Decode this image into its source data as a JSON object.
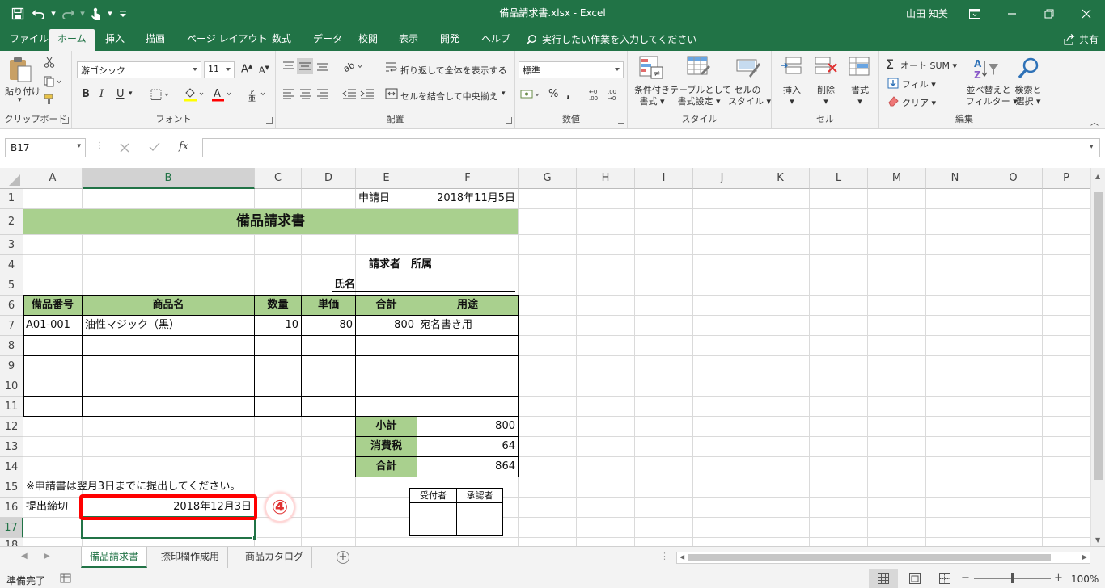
{
  "window": {
    "title": "備品請求書.xlsx  -  Excel",
    "user": "山田 知美"
  },
  "ribbon_tabs": [
    "ファイル",
    "ホーム",
    "挿入",
    "描画",
    "ページ レイアウト",
    "数式",
    "データ",
    "校閲",
    "表示",
    "開発",
    "ヘルプ"
  ],
  "active_tab": "ホーム",
  "search_placeholder": "実行したい作業を入力してください",
  "share_label": "共有",
  "ribbon": {
    "clipboard": {
      "label": "クリップボード",
      "paste": "貼り付け"
    },
    "font": {
      "label": "フォント",
      "name": "游ゴシック",
      "size": "11",
      "bold": "B",
      "italic": "I",
      "underline": "U"
    },
    "alignment": {
      "label": "配置",
      "wrap": "折り返して全体を表示する",
      "merge": "セルを結合して中央揃え"
    },
    "number": {
      "label": "数値",
      "format": "標準",
      "percent": "%"
    },
    "styles": {
      "label": "スタイル",
      "conditional": [
        "条件付き",
        "書式"
      ],
      "table": [
        "テーブルとして",
        "書式設定"
      ],
      "cell": [
        "セルの",
        "スタイル"
      ]
    },
    "cells": {
      "label": "セル",
      "insert": "挿入",
      "delete": "削除",
      "format": "書式"
    },
    "editing": {
      "label": "編集",
      "autosum": "オート SUM",
      "fill": "フィル",
      "clear": "クリア",
      "sort": [
        "並べ替えと",
        "フィルター"
      ],
      "find": [
        "検索と",
        "選択"
      ]
    }
  },
  "name_box": "B17",
  "columns": [
    "A",
    "B",
    "C",
    "D",
    "E",
    "F",
    "G",
    "H",
    "I",
    "J",
    "K",
    "L",
    "M",
    "N",
    "O",
    "P"
  ],
  "selected_column": "B",
  "rows": [
    "1",
    "2",
    "3",
    "4",
    "5",
    "6",
    "7",
    "8",
    "9",
    "10",
    "11",
    "12",
    "13",
    "14",
    "15",
    "16",
    "17",
    "18"
  ],
  "selected_row": "17",
  "sheet": {
    "request_date_label": "申請日",
    "request_date": "2018年11月5日",
    "title": "備品請求書",
    "requester_dept": "請求者　所属",
    "requester_name": "氏名",
    "headers": [
      "備品番号",
      "商品名",
      "数量",
      "単価",
      "合計",
      "用途"
    ],
    "items": [
      [
        "A01-001",
        "油性マジック（黒）",
        "10",
        "80",
        "800",
        "宛名書き用"
      ]
    ],
    "subtotal_label": "小計",
    "subtotal": "800",
    "tax_label": "消費税",
    "tax": "64",
    "total_label": "合計",
    "total": "864",
    "note": "※申請書は翌月3日までに提出してください。",
    "deadline_label": "提出締切",
    "deadline": "2018年12月3日",
    "stamp_headers": [
      "受付者",
      "承認者"
    ]
  },
  "callout": "④",
  "sheet_tabs": [
    "備品請求書",
    "捺印欄作成用",
    "商品カタログ"
  ],
  "active_sheet": "備品請求書",
  "status": {
    "ready": "準備完了",
    "zoom": "100%"
  },
  "colors": {
    "excel_green": "#217346",
    "header_green": "#a9d08e",
    "callout_red": "#ff0000",
    "callout_text": "#e03030"
  }
}
